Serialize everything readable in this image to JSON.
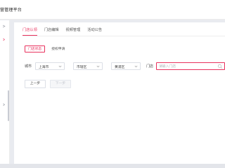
{
  "app": {
    "title": "营管理平台"
  },
  "tabs": [
    {
      "label": "门店认领",
      "active": true
    },
    {
      "label": "门店编辑",
      "active": false
    },
    {
      "label": "视频管理",
      "active": false
    },
    {
      "label": "活动公告",
      "active": false
    }
  ],
  "subtabs": [
    {
      "label": "门店状态",
      "active": true
    },
    {
      "label": "授权申请",
      "active": false
    }
  ],
  "filters": {
    "city_label": "城市",
    "province": "上海市",
    "city": "市辖区",
    "district": "黄浦区",
    "store_label": "门店",
    "store_placeholder": "请输入门店",
    "store_value": ""
  },
  "buttons": {
    "prev": "上一步",
    "next": "下一步"
  },
  "colors": {
    "accent": "#e8305c",
    "link": "#3b82c4"
  }
}
